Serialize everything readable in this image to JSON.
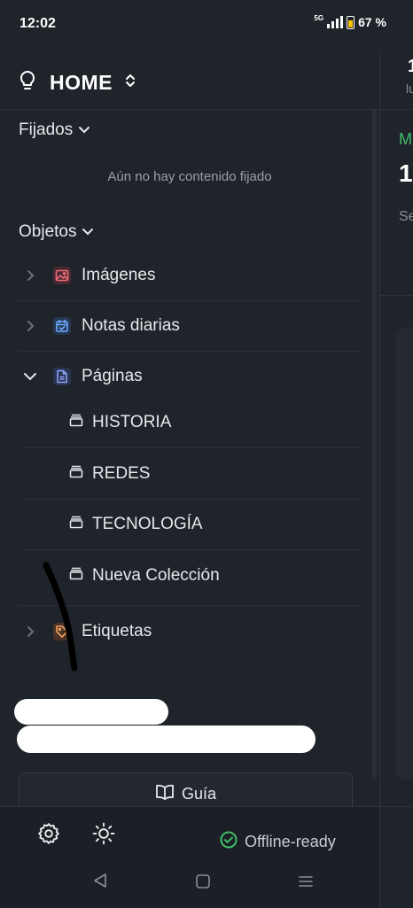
{
  "status_bar": {
    "time": "12:02",
    "network": "5G",
    "battery": "67 %"
  },
  "workspace": {
    "name": "HOME"
  },
  "pinned": {
    "title": "Fijados",
    "empty_text": "Aún no hay contenido fijado"
  },
  "objects": {
    "title": "Objetos",
    "items": [
      {
        "label": "Imágenes"
      },
      {
        "label": "Notas diarias"
      },
      {
        "label": "Páginas"
      },
      {
        "label": "Etiquetas"
      }
    ],
    "collections": [
      {
        "label": "HISTORIA"
      },
      {
        "label": "REDES"
      },
      {
        "label": "TECNOLOGÍA"
      },
      {
        "label": "Nueva Colección"
      }
    ]
  },
  "guide_button": {
    "label": "Guía"
  },
  "footer": {
    "status": "Offline-ready"
  },
  "right_pane": {
    "num1": "1",
    "small1": "lu",
    "green_letter": "M",
    "num2": "1",
    "small2": "Se"
  },
  "colors": {
    "background": "#1f232a",
    "accent_green": "#3fbf6a",
    "text": "#e6e8eb"
  }
}
